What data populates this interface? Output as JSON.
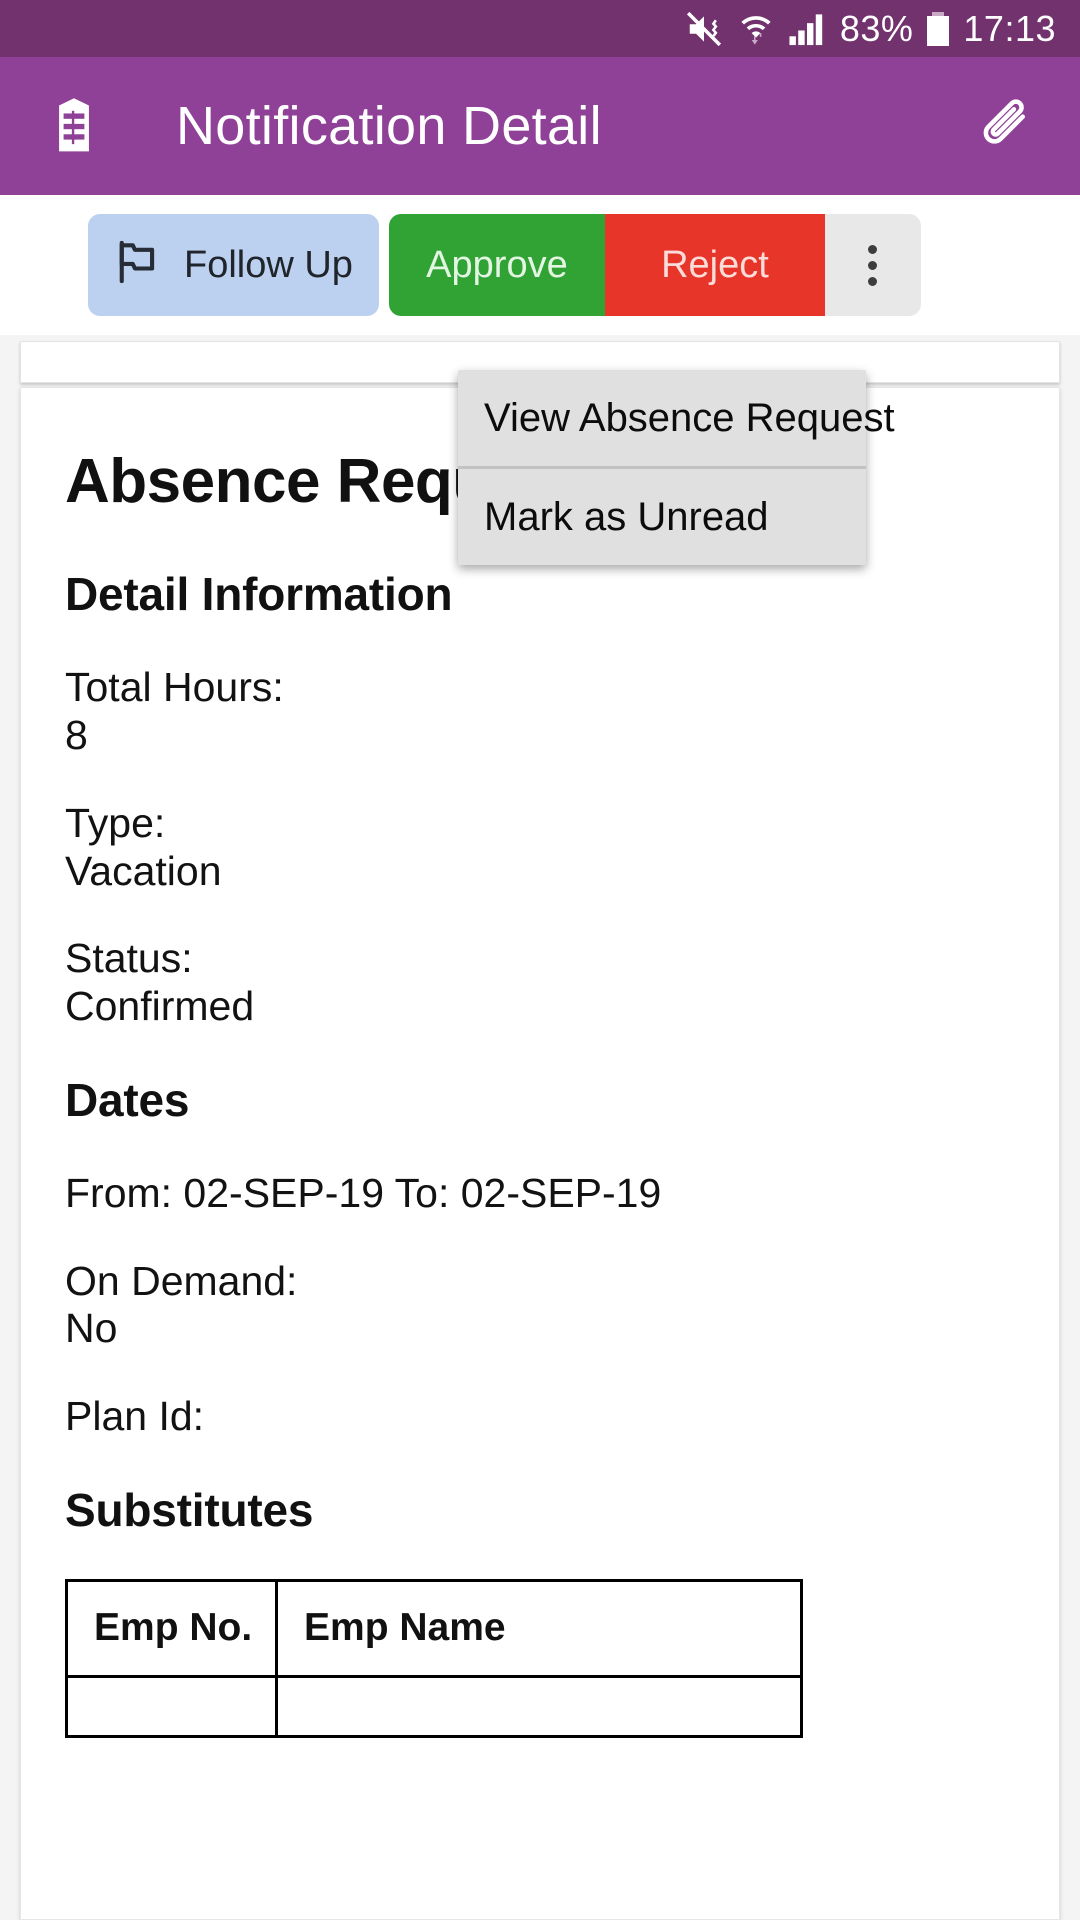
{
  "statusbar": {
    "battery_percent": "83%",
    "time": "17:13",
    "icons": [
      "mute-vibrate-icon",
      "wifi-icon",
      "signal-bars-icon",
      "battery-icon"
    ]
  },
  "appbar": {
    "title": "Notification Detail",
    "nav_icon": "menu-list-icon",
    "action_icon": "paperclip-icon",
    "bg_color": "#8e4196"
  },
  "actions": {
    "follow_up": "Follow Up",
    "approve": "Approve",
    "reject": "Reject",
    "more": "overflow-menu",
    "colors": {
      "approve": "#31a334",
      "reject": "#e8352a",
      "follow_up": "#bcd0ef"
    }
  },
  "overflow_menu": {
    "items": [
      {
        "label": "View Absence Request"
      },
      {
        "label": "Mark as Unread"
      }
    ]
  },
  "detail": {
    "title": "Absence Request",
    "section_detail": "Detail Information",
    "total_hours_label": "Total Hours:",
    "total_hours_value": "8",
    "type_label": "Type:",
    "type_value": "Vacation",
    "status_label": "Status:",
    "status_value": "Confirmed",
    "section_dates": "Dates",
    "dates_line": "From: 02-SEP-19 To: 02-SEP-19",
    "on_demand_label": "On Demand:",
    "on_demand_value": "No",
    "plan_id_label": "Plan Id:",
    "plan_id_value": "",
    "section_substitutes": "Substitutes",
    "substitutes_table": {
      "columns": [
        "Emp No.",
        "Emp Name"
      ],
      "rows": [
        [
          "",
          ""
        ]
      ]
    }
  }
}
